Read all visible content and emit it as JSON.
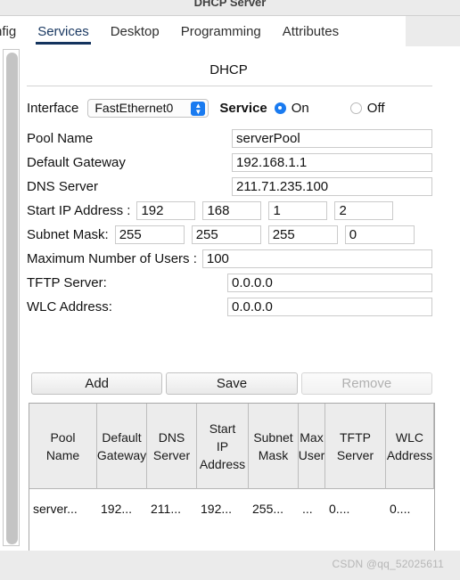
{
  "window": {
    "title": "DHCP Server"
  },
  "tabs": [
    {
      "label": "nfig",
      "active": false,
      "clipped": true
    },
    {
      "label": "Services",
      "active": true,
      "clipped": false
    },
    {
      "label": "Desktop",
      "active": false,
      "clipped": false
    },
    {
      "label": "Programming",
      "active": false,
      "clipped": false
    },
    {
      "label": "Attributes",
      "active": false,
      "clipped": false
    }
  ],
  "panel": {
    "heading": "DHCP",
    "interface": {
      "label": "Interface",
      "selected": "FastEthernet0",
      "options": [
        "FastEthernet0"
      ]
    },
    "service": {
      "label": "Service",
      "on_label": "On",
      "off_label": "Off",
      "value": "On"
    },
    "fields": {
      "pool_name": {
        "label": "Pool Name",
        "value": "serverPool"
      },
      "default_gateway": {
        "label": "Default Gateway",
        "value": "192.168.1.1"
      },
      "dns_server": {
        "label": "DNS Server",
        "value": "211.71.235.100"
      },
      "start_ip": {
        "label": "Start IP Address :",
        "octets": [
          "192",
          "168",
          "1",
          "2"
        ]
      },
      "subnet_mask": {
        "label": "Subnet Mask:",
        "octets": [
          "255",
          "255",
          "255",
          "0"
        ]
      },
      "max_users": {
        "label": "Maximum Number of Users :",
        "value": "100"
      },
      "tftp_server": {
        "label": "TFTP Server:",
        "value": "0.0.0.0"
      },
      "wlc_address": {
        "label": "WLC Address:",
        "value": "0.0.0.0"
      }
    },
    "buttons": {
      "add": "Add",
      "save": "Save",
      "remove": "Remove",
      "remove_disabled": true
    },
    "table": {
      "headers": [
        "Pool Name",
        "Default Gateway",
        "DNS Server",
        "Start IP Address",
        "Subnet Mask",
        "Max User",
        "TFTP Server",
        "WLC Address"
      ],
      "headers_rendered": [
        "Pool\nName",
        "Default\nGateway",
        "DNS\nServer",
        "Start\nIP\nAddress",
        "Subnet\nMask",
        "Max\nUser",
        "TFTP\nServer",
        "WLC\nAddress"
      ],
      "rows": [
        [
          "server...",
          "192...",
          "211...",
          "192...",
          "255...",
          "...",
          "0....",
          "0...."
        ]
      ]
    }
  },
  "footer": {
    "watermark": "CSDN @qq_52025611"
  },
  "colors": {
    "accent_blue": "#1a7bf0",
    "active_tab": "#14345e",
    "panel_bg": "#ffffff",
    "chrome_bg": "#ebebeb"
  }
}
